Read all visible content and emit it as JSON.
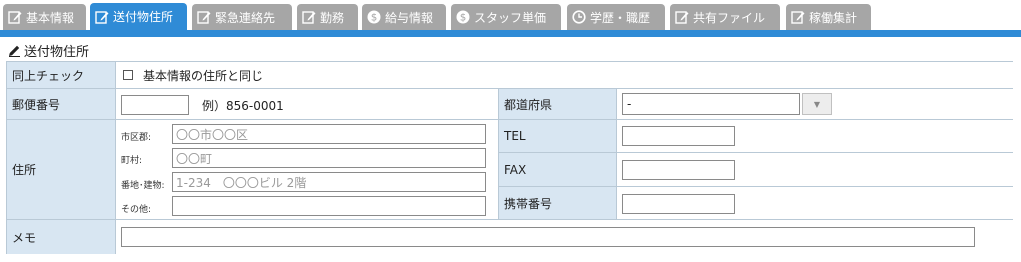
{
  "tabs": [
    {
      "label": "基本情報",
      "icon": "edit-icon"
    },
    {
      "label": "送付物住所",
      "icon": "edit-icon",
      "active": true
    },
    {
      "label": "緊急連絡先",
      "icon": "edit-icon"
    },
    {
      "label": "勤務",
      "icon": "edit-icon"
    },
    {
      "label": "給与情報",
      "icon": "dollar-icon"
    },
    {
      "label": "スタッフ単価",
      "icon": "dollar-icon"
    },
    {
      "label": "学歴・職歴",
      "icon": "clock-icon"
    },
    {
      "label": "共有ファイル",
      "icon": "edit-icon"
    },
    {
      "label": "稼働集計",
      "icon": "edit-icon"
    }
  ],
  "section": {
    "title": "送付物住所",
    "icon": "pencil-icon"
  },
  "form": {
    "same_check": {
      "label": "同上チェック",
      "checkbox_label": "基本情報の住所と同じ",
      "checked": false
    },
    "postal": {
      "label": "郵便番号",
      "value": "",
      "example": "例）856-0001"
    },
    "prefecture": {
      "label": "都道府県",
      "value": "-"
    },
    "address": {
      "label": "住所",
      "city": {
        "label": "市区郡:",
        "placeholder": "〇〇市〇〇区"
      },
      "town": {
        "label": "町村:",
        "placeholder": "〇〇町"
      },
      "street": {
        "label": "番地･建物:",
        "placeholder": "1-234　〇〇〇ビル 2階"
      },
      "other": {
        "label": "その他:",
        "placeholder": ""
      }
    },
    "tel": {
      "label": "TEL",
      "value": ""
    },
    "fax": {
      "label": "FAX",
      "value": ""
    },
    "mobile": {
      "label": "携帯番号",
      "value": ""
    },
    "memo": {
      "label": "メモ",
      "value": ""
    }
  },
  "colors": {
    "accent": "#2f8bd6",
    "tab_inactive": "#a6a6a6",
    "label_bg": "#d8e6f2",
    "border": "#b9c9d6"
  }
}
